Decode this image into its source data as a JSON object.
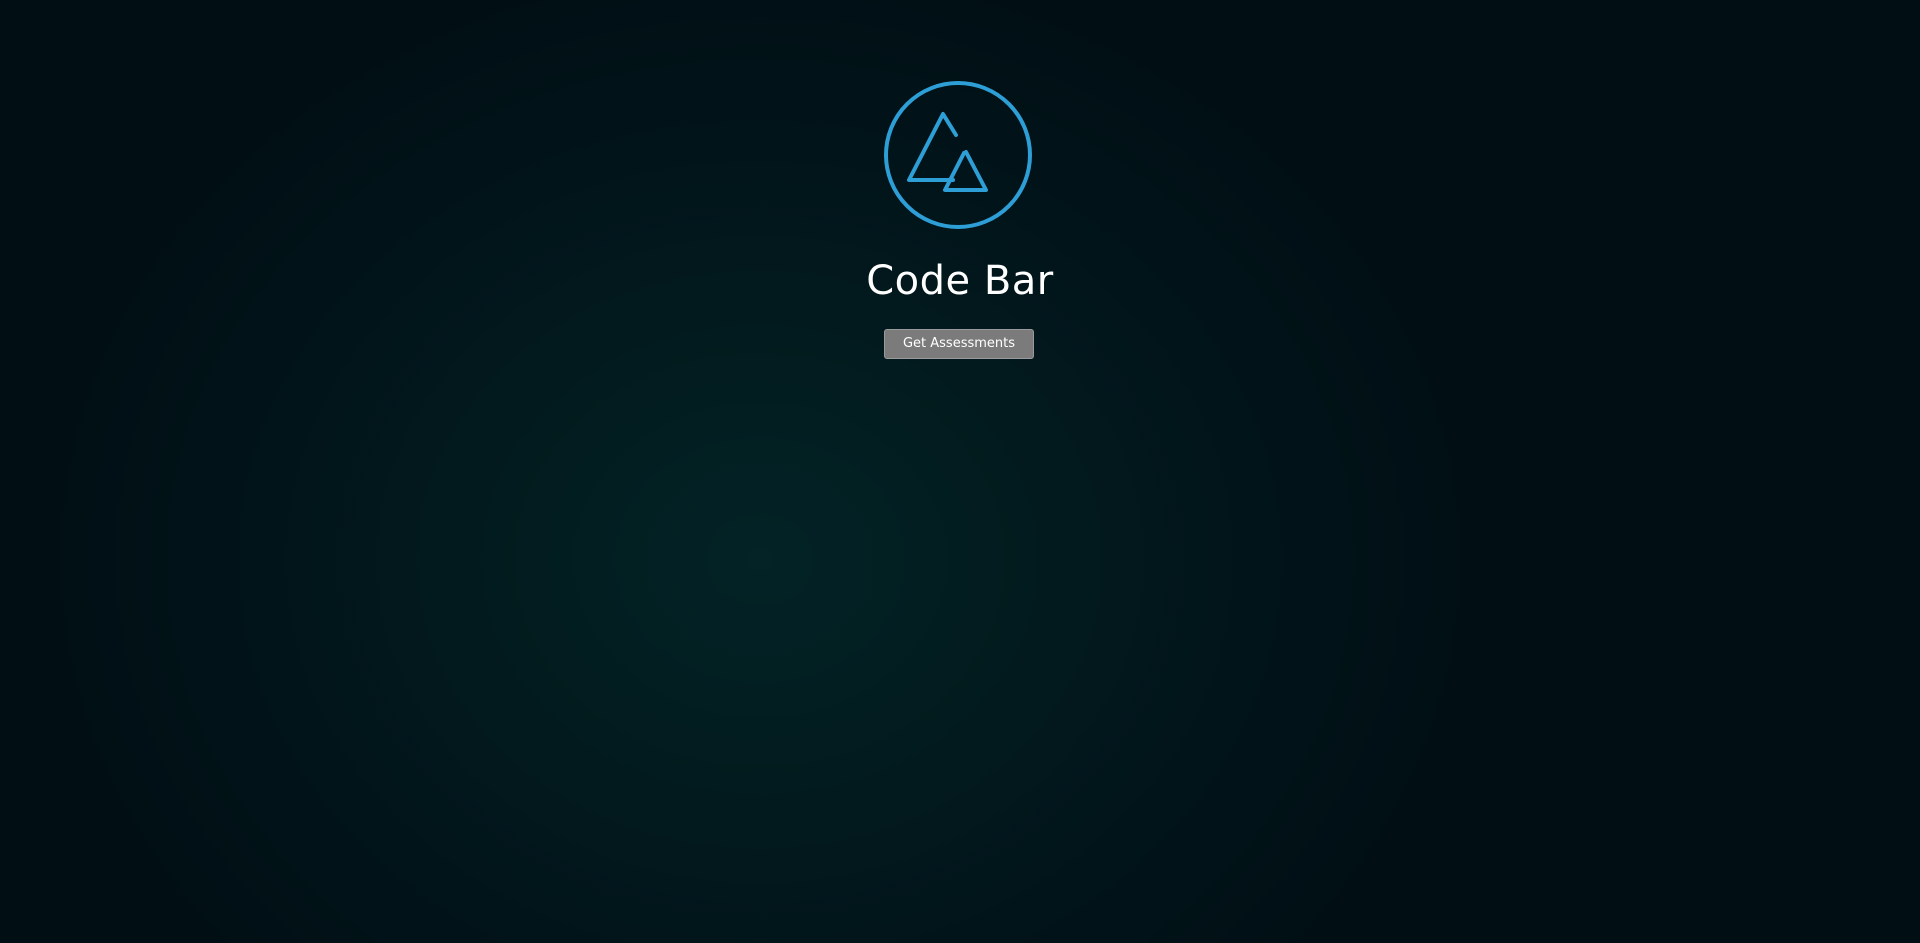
{
  "brand": {
    "name": "Code Bar",
    "logo_icon": "mountain-circle-icon",
    "accent_color": "#2e9fd6"
  },
  "actions": {
    "get_assessments_label": "Get Assessments",
    "button_color": "#7b7b7b"
  },
  "background": {
    "center_color": "#032326",
    "edge_color": "#010e13"
  }
}
